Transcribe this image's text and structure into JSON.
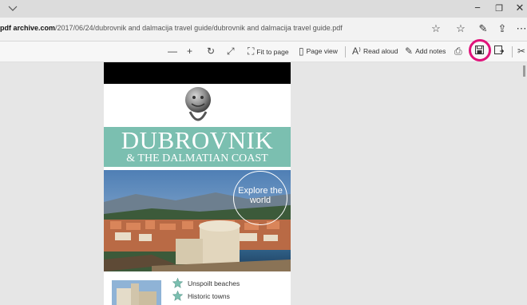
{
  "titlebar": {
    "tabs_chevron": "chevron-down-icon",
    "minimize": "−",
    "restore": "❐",
    "close": "✕"
  },
  "address": {
    "url_host": "pdf archive.com",
    "url_path": "/2017/06/24/dubrovnik and dalmacija travel guide/dubrovnik and dalmacija travel guide.pdf",
    "icons": [
      "favorite-star-icon",
      "favorites-list-icon",
      "pen-icon",
      "share-icon",
      "more-icon"
    ]
  },
  "pdf_toolbar": {
    "zoom_out": "—",
    "zoom_in": "+",
    "fit_to_page": "Fit to page",
    "page_view": "Page view",
    "read_aloud": "Read aloud",
    "add_notes": "Add notes",
    "icons": [
      "rotate-icon",
      "fullscreen-icon",
      "print-icon",
      "save-icon",
      "save-as-icon",
      "pin-icon"
    ],
    "highlight_color": "#e0137a"
  },
  "document": {
    "title_line1": "DUBROVNIK",
    "title_line2": "& THE DALMATIAN COAST",
    "badge": "Explore the world",
    "features": [
      "Unspoilt beaches",
      "Historic towns"
    ],
    "teal_color": "#7bbfb0"
  }
}
